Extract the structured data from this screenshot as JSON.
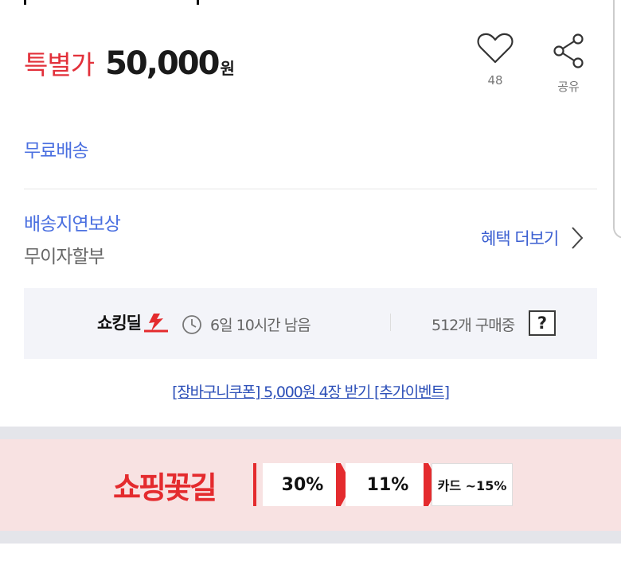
{
  "price": {
    "label": "특별가",
    "value": "50,000",
    "unit": "원"
  },
  "actions": {
    "like_count": "48",
    "share_label": "공유"
  },
  "shipping": {
    "free": "무료배송"
  },
  "benefits": {
    "delay_comp": "배송지연보상",
    "no_interest": "무이자할부",
    "more_label": "혜택 더보기"
  },
  "deal": {
    "logo_text": "쇼킹딜",
    "time_remaining": "6일 10시간 남음",
    "buying_count": "512개 구매중",
    "help_label": "?"
  },
  "coupon": {
    "link_text": "[장바구니쿠폰] 5,000원 4장 받기 [추가이벤트]"
  },
  "banner": {
    "brand": "쇼핑꽃길",
    "chip1": "30%",
    "chip2": "11%",
    "chip3": "카드 ~15%"
  },
  "colors": {
    "price_red": "#e2303a",
    "link_blue": "#4a6fe0",
    "banner_bg": "#f8e2e2",
    "banner_red": "#e42b2e"
  }
}
